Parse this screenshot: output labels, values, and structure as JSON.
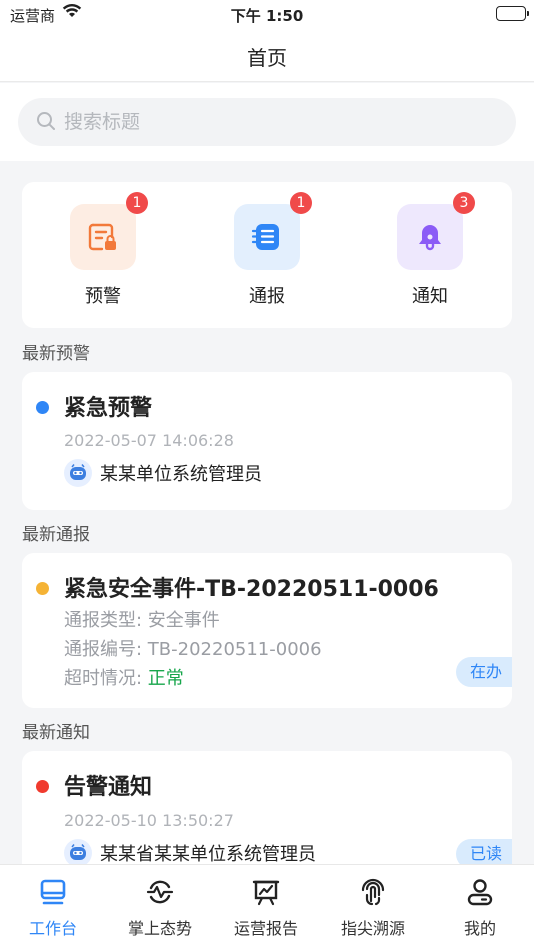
{
  "status_bar": {
    "carrier": "运营商",
    "time": "下午 1:50"
  },
  "nav": {
    "title": "首页"
  },
  "search": {
    "placeholder": "搜索标题"
  },
  "quick_actions": [
    {
      "label": "预警",
      "badge": "1"
    },
    {
      "label": "通报",
      "badge": "1"
    },
    {
      "label": "通知",
      "badge": "3"
    }
  ],
  "sections": {
    "alert": {
      "header": "最新预警",
      "title": "紧急预警",
      "time": "2022-05-07 14:06:28",
      "user": "某某单位系统管理员"
    },
    "report": {
      "header": "最新通报",
      "title": "紧急安全事件-TB-20220511-0006",
      "type_label": "通报类型: ",
      "type_value": "安全事件",
      "number_label": "通报编号: ",
      "number_value": "TB-20220511-0006",
      "timeout_label": "超时情况: ",
      "timeout_value": "正常",
      "status_tag": "在办"
    },
    "notice": {
      "header": "最新通知",
      "title": "告警通知",
      "time": "2022-05-10 13:50:27",
      "user": "某某省某某单位系统管理员",
      "status_tag": "已读"
    }
  },
  "tabs": [
    {
      "label": "工作台",
      "icon": "workbench-icon",
      "active": true
    },
    {
      "label": "掌上态势",
      "icon": "situation-icon"
    },
    {
      "label": "运营报告",
      "icon": "report-chart-icon"
    },
    {
      "label": "指尖溯源",
      "icon": "fingerprint-icon"
    },
    {
      "label": "我的",
      "icon": "user-icon"
    }
  ],
  "colors": {
    "accent": "#2f86f6",
    "badge": "#f04a4a",
    "dot_blue": "#2f86f6",
    "dot_orange": "#f5b335",
    "dot_red": "#f03a2e",
    "ok_green": "#17a64b"
  }
}
